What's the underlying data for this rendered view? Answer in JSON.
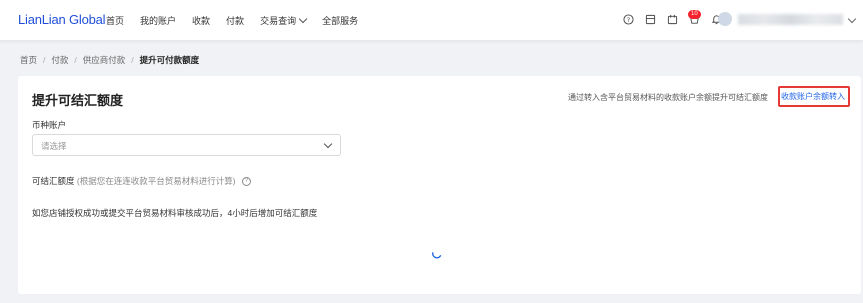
{
  "header": {
    "logo": "LianLian Global",
    "nav": [
      {
        "label": "首页"
      },
      {
        "label": "我的账户"
      },
      {
        "label": "收款"
      },
      {
        "label": "付款"
      },
      {
        "label": "交易查询"
      },
      {
        "label": "全部服务"
      }
    ],
    "notification_count": "10"
  },
  "breadcrumb": [
    "首页",
    "付款",
    "供应商付款",
    "提升可付款额度"
  ],
  "card": {
    "title": "提升可结汇额度",
    "hint_text": "通过转入含平台贸易材料的收款账户余额提升可结汇额度",
    "hint_link": "收款账户余额转入",
    "currency_label": "币种账户",
    "currency_placeholder": "请选择",
    "quota_label": "可结汇额度",
    "quota_sub": "(根据您在连连收款平台贸易材料进行计算)",
    "notice": "如您店铺授权成功或提交平台贸易材料审核成功后，4小时后增加可结汇额度"
  },
  "colors": {
    "brand": "#1f4fd8",
    "link": "#1f63e6",
    "highlight_border": "#e53935",
    "badge": "#f5222d"
  }
}
